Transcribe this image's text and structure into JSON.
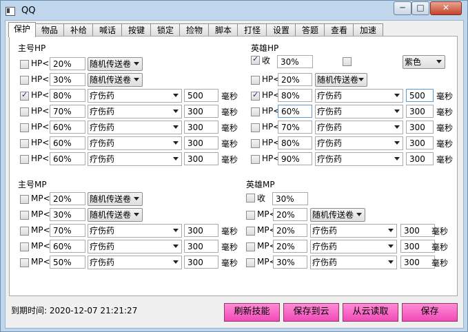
{
  "window": {
    "title": "QQ",
    "min_glyph": "─",
    "max_glyph": "□",
    "close_glyph": "✕"
  },
  "tabs": [
    "保护",
    "物品",
    "补给",
    "喊话",
    "按键",
    "锁定",
    "捡物",
    "脚本",
    "打怪",
    "设置",
    "答题",
    "查看",
    "加速"
  ],
  "main_hp": {
    "title": "主号HP",
    "rows": [
      {
        "label": "HP<",
        "checked": false,
        "value": "20%",
        "item": "随机传送卷",
        "ms": "",
        "unit": ""
      },
      {
        "label": "HP<",
        "checked": false,
        "value": "30%",
        "item": "随机传送卷",
        "ms": "",
        "unit": ""
      },
      {
        "label": "HP<",
        "checked": true,
        "value": "80%",
        "item": "疗伤药",
        "ms": "500",
        "unit": "毫秒"
      },
      {
        "label": "HP<",
        "checked": false,
        "value": "70%",
        "item": "疗伤药",
        "ms": "300",
        "unit": "毫秒"
      },
      {
        "label": "HP<",
        "checked": false,
        "value": "60%",
        "item": "疗伤药",
        "ms": "300",
        "unit": "毫秒"
      },
      {
        "label": "HP<",
        "checked": false,
        "value": "60%",
        "item": "疗伤药",
        "ms": "300",
        "unit": "毫秒"
      },
      {
        "label": "HP<",
        "checked": false,
        "value": "60%",
        "item": "疗伤药",
        "ms": "300",
        "unit": "毫秒"
      }
    ]
  },
  "hero_hp": {
    "title": "英雄HP",
    "recall": {
      "label": "收",
      "checked": true,
      "value": "30%"
    },
    "color_checked": false,
    "color": "紫色",
    "rows": [
      {
        "label": "HP<",
        "checked": false,
        "value": "20%",
        "item": "随机传送卷",
        "ms": "",
        "unit": ""
      },
      {
        "label": "HP<",
        "checked": true,
        "value": "80%",
        "item": "疗伤药",
        "ms": "500",
        "unit": "毫秒"
      },
      {
        "label": "HP<",
        "checked": false,
        "value": "60%",
        "item": "疗伤药",
        "ms": "300",
        "unit": "毫秒"
      },
      {
        "label": "HP<",
        "checked": false,
        "value": "70%",
        "item": "疗伤药",
        "ms": "300",
        "unit": "毫秒"
      },
      {
        "label": "HP<",
        "checked": false,
        "value": "80%",
        "item": "疗伤药",
        "ms": "300",
        "unit": "毫秒"
      },
      {
        "label": "HP<",
        "checked": false,
        "value": "90%",
        "item": "疗伤药",
        "ms": "300",
        "unit": "毫秒"
      }
    ]
  },
  "main_mp": {
    "title": "主号MP",
    "rows": [
      {
        "label": "MP<",
        "checked": false,
        "value": "20%",
        "item": "随机传送卷",
        "ms": "",
        "unit": ""
      },
      {
        "label": "MP<",
        "checked": false,
        "value": "30%",
        "item": "随机传送卷",
        "ms": "",
        "unit": ""
      },
      {
        "label": "MP<",
        "checked": false,
        "value": "70%",
        "item": "疗伤药",
        "ms": "300",
        "unit": "毫秒"
      },
      {
        "label": "MP<",
        "checked": false,
        "value": "60%",
        "item": "疗伤药",
        "ms": "300",
        "unit": "毫秒"
      },
      {
        "label": "MP<",
        "checked": false,
        "value": "50%",
        "item": "疗伤药",
        "ms": "300",
        "unit": "毫秒"
      }
    ]
  },
  "hero_mp": {
    "title": "英雄MP",
    "recall": {
      "label": "收",
      "checked": false,
      "value": "30%"
    },
    "rows": [
      {
        "label": "MP<",
        "checked": false,
        "value": "20%",
        "item": "随机传送卷",
        "ms": "",
        "unit": ""
      },
      {
        "label": "MP<",
        "checked": false,
        "value": "20%",
        "item": "疗伤药",
        "ms": "300",
        "unit": "毫秒"
      },
      {
        "label": "MP<",
        "checked": false,
        "value": "20%",
        "item": "疗伤药",
        "ms": "300",
        "unit": "毫秒"
      },
      {
        "label": "MP<",
        "checked": false,
        "value": "30%",
        "item": "疗伤药",
        "ms": "300",
        "unit": "毫秒"
      }
    ]
  },
  "footer": {
    "expiry_label": "到期时间:",
    "expiry_value": "2020-12-07 21:21:27",
    "refresh_label": "刷新技能",
    "save_cloud_label": "保存到云",
    "load_cloud_label": "从云读取",
    "save_label": "保存"
  }
}
